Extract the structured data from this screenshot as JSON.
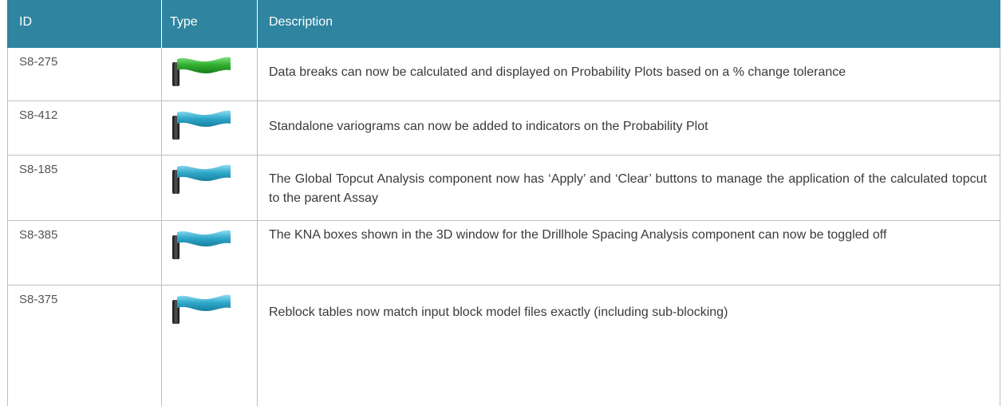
{
  "header": {
    "col_id": "ID",
    "col_type": "Type",
    "col_description": "Description"
  },
  "rows": [
    {
      "id": "S8-275",
      "type_icon": "green-flag-icon",
      "flag_color": "#3fa63f",
      "description": "Data breaks can now be calculated and displayed on Probability Plots based on a % change tolerance"
    },
    {
      "id": "S8-412",
      "type_icon": "blue-flag-icon",
      "flag_color": "#2ea7c9",
      "description": "Standalone variograms can now be added to indicators on the Probability Plot"
    },
    {
      "id": "S8-185",
      "type_icon": "blue-flag-icon",
      "flag_color": "#2ea7c9",
      "description": "The Global Topcut Analysis component now has ‘Apply’ and ‘Clear’ buttons to manage the application of the calculated topcut to the parent Assay"
    },
    {
      "id": "S8-385",
      "type_icon": "blue-flag-icon",
      "flag_color": "#2ea7c9",
      "description": "The KNA boxes shown in the 3D window for the Drillhole Spacing Analysis component can now be toggled off"
    },
    {
      "id": "S8-375",
      "type_icon": "blue-flag-icon",
      "flag_color": "#2ea7c9",
      "description": "Reblock tables now match input block model files exactly (including sub-blocking)"
    }
  ],
  "colors": {
    "header_bg": "#2f84a0",
    "grid_line": "#bfbfbf"
  }
}
